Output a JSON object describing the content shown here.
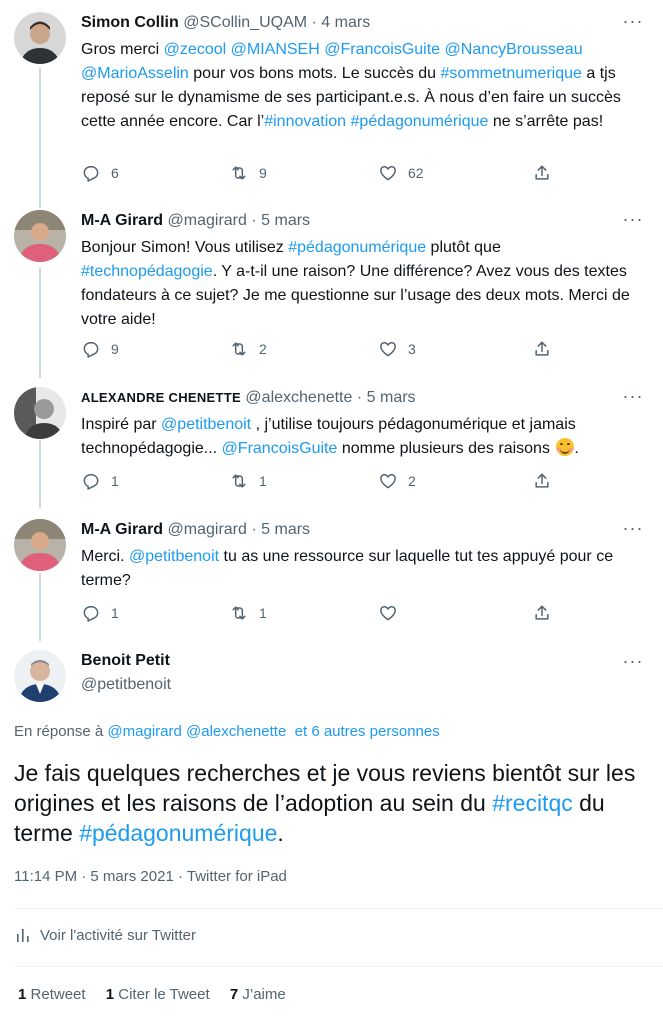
{
  "tweets": [
    {
      "name": "Simon Collin",
      "handle": "@SCollin_UQAM",
      "date": "4 mars",
      "body": [
        {
          "t": "Gros merci ",
          "link": false
        },
        {
          "t": "@zecool",
          "link": true
        },
        {
          "t": " ",
          "link": false
        },
        {
          "t": "@MIANSEH",
          "link": true
        },
        {
          "t": " ",
          "link": false
        },
        {
          "t": "@FrancoisGuite",
          "link": true
        },
        {
          "t": " ",
          "link": false
        },
        {
          "t": "@NancyBrousseau",
          "link": true
        },
        {
          "t": " ",
          "link": false
        },
        {
          "t": "@MarioAsselin",
          "link": true
        },
        {
          "t": " pour vos bons mots. Le succès du ",
          "link": false
        },
        {
          "t": "#sommetnumerique",
          "link": true
        },
        {
          "t": " a tjs reposé sur le dynamisme de ses participant.e.s. À nous d’en faire un succès cette année encore. Car l’",
          "link": false
        },
        {
          "t": "#innovation",
          "link": true
        },
        {
          "t": " ",
          "link": false
        },
        {
          "t": "#pédagonumérique",
          "link": true
        },
        {
          "t": " ne s’arrête pas!",
          "link": false
        }
      ],
      "replies": "6",
      "retweets": "9",
      "likes": "62"
    },
    {
      "name": "M-A Girard",
      "handle": "@magirard",
      "date": "5 mars",
      "body": [
        {
          "t": "Bonjour Simon! Vous utilisez ",
          "link": false
        },
        {
          "t": "#pédagonumérique",
          "link": true
        },
        {
          "t": " plutôt que ",
          "link": false
        },
        {
          "t": "#technopédagogie",
          "link": true
        },
        {
          "t": ". Y a-t-il une raison? Une différence? Avez vous des textes fondateurs à ce sujet? Je me questionne sur l’usage des deux mots. Merci de votre aide!",
          "link": false
        }
      ],
      "replies": "9",
      "retweets": "2",
      "likes": "3"
    },
    {
      "name": "ALEXANDRE CHENETTE",
      "handle": "@alexchenette",
      "date": "5 mars",
      "body": [
        {
          "t": "Inspiré par ",
          "link": false
        },
        {
          "t": "@petitbenoit",
          "link": true
        },
        {
          "t": " , j’utilise toujours pédagonumérique et jamais technopédagogie... ",
          "link": false
        },
        {
          "t": "@FrancoisGuite",
          "link": true
        },
        {
          "t": " nomme plusieurs des raisons ",
          "link": false
        }
      ],
      "emoji": "smiling-face-emoji",
      "replies": "1",
      "retweets": "1",
      "likes": "2"
    },
    {
      "name": "M-A Girard",
      "handle": "@magirard",
      "date": "5 mars",
      "body": [
        {
          "t": "Merci. ",
          "link": false
        },
        {
          "t": "@petitbenoit",
          "link": true
        },
        {
          "t": " tu as une ressource sur laquelle tut tes appuyé pour ce terme?",
          "link": false
        }
      ],
      "replies": "1",
      "retweets": "1",
      "likes": ""
    }
  ],
  "main": {
    "name": "Benoit Petit",
    "handle": "@petitbenoit",
    "reply_prefix": "En réponse à ",
    "reply_users": [
      "@magirard",
      "@alexchenette"
    ],
    "reply_others": "et 6 autres personnes",
    "text": [
      {
        "t": "Je fais quelques recherches et je vous reviens bientôt sur les origines et les raisons de l’adoption au sein du ",
        "link": false
      },
      {
        "t": "#recitqc",
        "link": true
      },
      {
        "t": " du terme ",
        "link": false
      },
      {
        "t": "#pédagonumérique",
        "link": true
      },
      {
        "t": ".",
        "link": false
      }
    ],
    "time": "11:14 PM · 5 mars 2021 · Twitter for iPad",
    "activity_label": "Voir l'activité sur Twitter",
    "stats": {
      "retweets_count": "1",
      "retweets_label": "Retweet",
      "quotes_count": "1",
      "quotes_label": "Citer le Tweet",
      "likes_count": "7",
      "likes_label": "J’aime"
    }
  },
  "more_glyph": "···",
  "colors": {
    "link": "#1d9bf0",
    "secondary": "#536471",
    "text": "#0f1419",
    "line": "#cfd9de"
  }
}
